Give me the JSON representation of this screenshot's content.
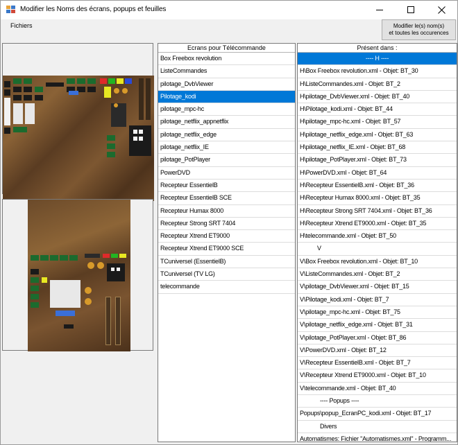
{
  "window": {
    "title": "Modifier les Noms des écrans, popups et feuilles"
  },
  "menu": {
    "fichiers": "Fichiers"
  },
  "modify_button": {
    "line1": "Modifier le(s) nom(s)",
    "line2": "et toutes les occurences"
  },
  "ecrans": {
    "header": "Ecrans pour Télécommande",
    "items": [
      "Box Freebox revolution",
      "ListeCommandes",
      "pilotage_DvbViewer",
      "Pilotage_kodi",
      "pilotage_mpc-hc",
      "pilotage_netflix_appnetflix",
      "pilotage_netflix_edge",
      "pilotage_netflix_IE",
      "pilotage_PotPlayer",
      "PowerDVD",
      "Recepteur EssentielB",
      "Recepteur EssentielB SCE",
      "Recepteur Humax 8000",
      "Recepteur Strong SRT 7404",
      "Recepteur Xtrend ET9000",
      "Recepteur Xtrend ET9000 SCE",
      "TCuniversel (EssentielB)",
      "TCuniversel (TV LG)",
      "telecommande"
    ],
    "selected_index": 3
  },
  "present": {
    "header": "Présent dans :",
    "items": [
      "---- H ----",
      "H\\Box Freebox revolution.xml - Objet: BT_30",
      "H\\ListeCommandes.xml - Objet: BT_2",
      "H\\pilotage_DvbViewer.xml - Objet: BT_40",
      "H\\Pilotage_kodi.xml - Objet: BT_44",
      "H\\pilotage_mpc-hc.xml - Objet: BT_57",
      "H\\pilotage_netflix_edge.xml - Objet: BT_63",
      "H\\pilotage_netflix_IE.xml - Objet: BT_68",
      "H\\pilotage_PotPlayer.xml - Objet: BT_73",
      "H\\PowerDVD.xml - Objet: BT_64",
      "H\\Recepteur EssentielB.xml - Objet: BT_36",
      "H\\Recepteur Humax 8000.xml - Objet: BT_35",
      "H\\Recepteur Strong SRT 7404.xml - Objet: BT_36",
      "H\\Recepteur Xtrend ET9000.xml - Objet: BT_35",
      "H\\telecommande.xml - Objet: BT_50",
      "V",
      "V\\Box Freebox revolution.xml - Objet: BT_10",
      "V\\ListeCommandes.xml - Objet: BT_2",
      "V\\pilotage_DvbViewer.xml - Objet: BT_15",
      "V\\Pilotage_kodi.xml - Objet: BT_7",
      "V\\pilotage_mpc-hc.xml - Objet: BT_75",
      "V\\pilotage_netflix_edge.xml - Objet: BT_31",
      "V\\pilotage_PotPlayer.xml - Objet: BT_86",
      "V\\PowerDVD.xml - Objet: BT_12",
      "V\\Recepteur EssentielB.xml - Objet: BT_7",
      "V\\Recepteur Xtrend ET9000.xml - Objet: BT_10",
      "V\\telecommande.xml - Objet: BT_40",
      "---- Popups ----",
      "Popups\\popup_EcranPC_kodi.xml - Objet: BT_17",
      "Divers",
      "Automatismes: Fichier \"Automatismes.xml\" - Programm..."
    ],
    "selected_index": 0,
    "styles": {
      "0": "center",
      "15": "indent",
      "27": "indent-more",
      "29": "indent-more"
    }
  },
  "colors": {
    "selection": "#0078d7"
  }
}
